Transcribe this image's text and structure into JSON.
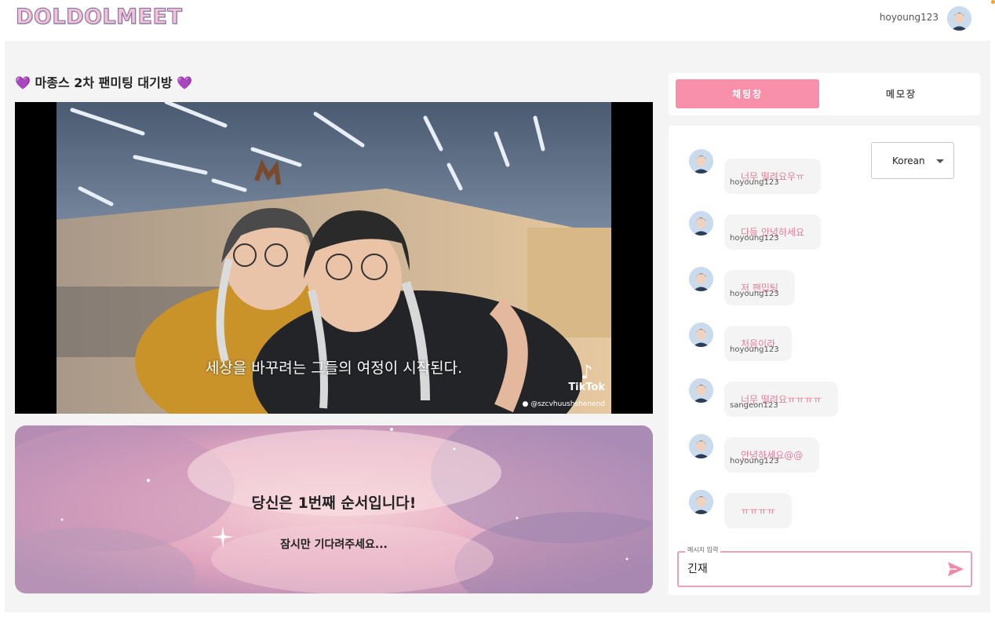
{
  "header": {
    "logo": "DOLDOLMEET",
    "username": "hoyoung123"
  },
  "room": {
    "title": "마종스 2차 팬미팅 대기방",
    "heart": "💜"
  },
  "video": {
    "subtitle": "세상을 바꾸려는 그들의 여정이 시작된다.",
    "watermark": "TikTok",
    "handle": "@szcvhuushshenend"
  },
  "queue": {
    "main": "당신은 1번째 순서입니다!",
    "sub": "잠시만 기다려주세요..."
  },
  "tabs": {
    "chat": "채팅창",
    "memo": "메모장"
  },
  "language": {
    "selected": "Korean"
  },
  "messages": [
    {
      "sender": "",
      "text": "너무 떨려요우ㅠ"
    },
    {
      "sender": "hoyoung123",
      "text": "다들 안녕하세요"
    },
    {
      "sender": "hoyoung123",
      "text": "저 팬밉팅"
    },
    {
      "sender": "hoyoung123",
      "text": "처음이라"
    },
    {
      "sender": "hoyoung123",
      "text": "너무 떨려요ㅠㅠㅠㅠ"
    },
    {
      "sender": "sangeon123",
      "text": "안녕하세요@@"
    },
    {
      "sender": "hoyoung123",
      "text": "ㅠㅠㅠㅠ"
    }
  ],
  "input": {
    "legend": "메시지 입력",
    "value": "긴재"
  },
  "colors": {
    "accent_pink": "#f890ab",
    "bubble_text": "#e47d9a",
    "panel_bg": "#f4f4f4"
  }
}
